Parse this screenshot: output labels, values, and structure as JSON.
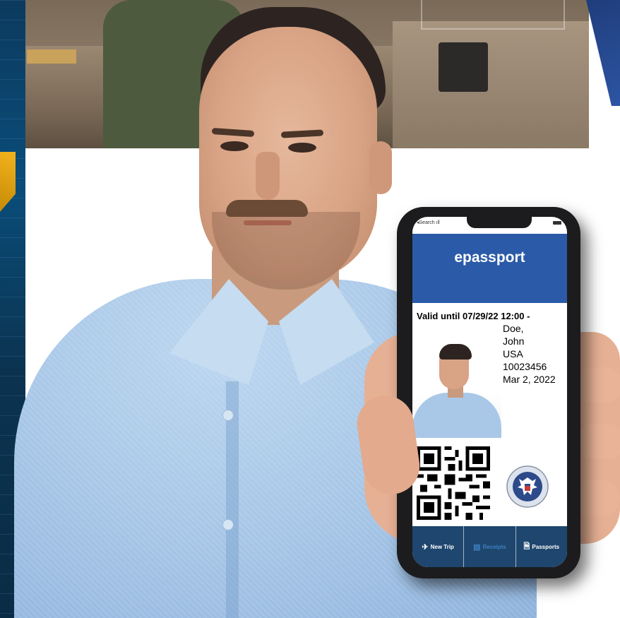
{
  "phone": {
    "status_back": "◂Search ıll",
    "app_title": "epassport",
    "valid_until": "Valid until 07/29/22 12:00 -",
    "passport": {
      "surname": "Doe,",
      "given_name": "John",
      "nationality": "USA",
      "passport_number": "10023456",
      "date": "Mar 2, 2022"
    },
    "tabs": [
      {
        "label": "New Trip",
        "icon": "airplane-icon"
      },
      {
        "label": "Receipts",
        "icon": "receipt-icon"
      },
      {
        "label": "Passports",
        "icon": "document-icon"
      }
    ]
  },
  "colors": {
    "app_header": "#2b5ba8",
    "tab_bar": "#1e466e",
    "dim_tab": "#3f7fc0"
  }
}
